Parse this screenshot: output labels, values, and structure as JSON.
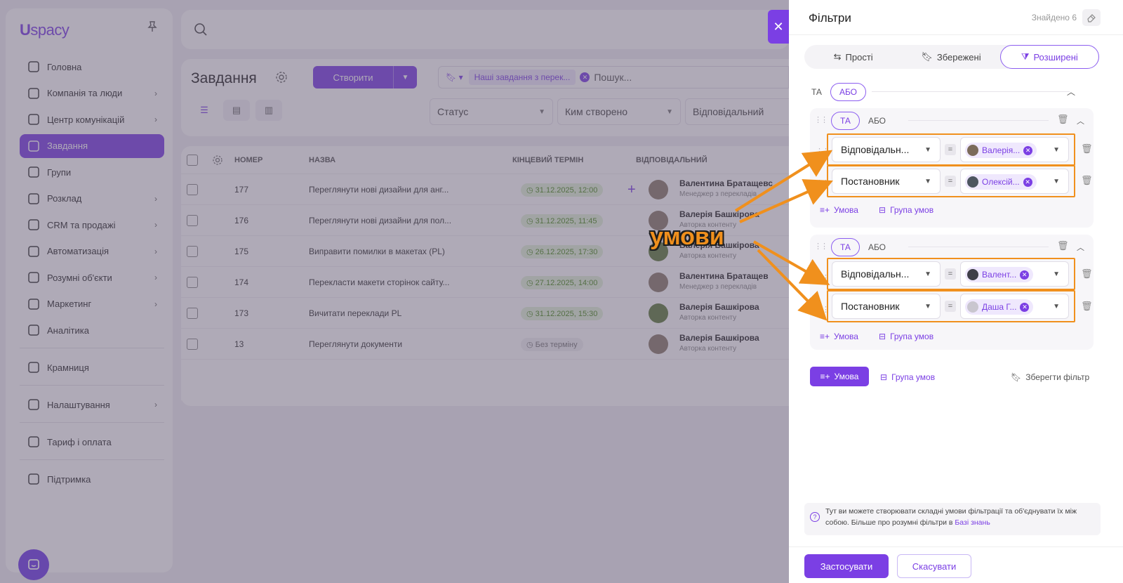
{
  "app": {
    "logo_mark": "U",
    "logo_text": "spacy",
    "nav": [
      {
        "label": "Головна",
        "icon": "home-icon",
        "chevron": false
      },
      {
        "label": "Компанія та люди",
        "icon": "company-icon",
        "chevron": true
      },
      {
        "label": "Центр комунікацій",
        "icon": "chat-center-icon",
        "chevron": true
      },
      {
        "label": "Завдання",
        "icon": "check-circle-icon",
        "chevron": false,
        "active": true
      },
      {
        "label": "Групи",
        "icon": "groups-icon",
        "chevron": false
      },
      {
        "label": "Розклад",
        "icon": "calendar-icon",
        "chevron": true
      },
      {
        "label": "CRM та продажі",
        "icon": "database-icon",
        "chevron": true
      },
      {
        "label": "Автоматизація",
        "icon": "lightning-icon",
        "chevron": true
      },
      {
        "label": "Розумні об'єкти",
        "icon": "smart-objects-icon",
        "chevron": true
      },
      {
        "label": "Маркетинг",
        "icon": "marketing-icon",
        "chevron": true
      },
      {
        "label": "Аналітика",
        "icon": "analytics-icon",
        "chevron": false
      }
    ],
    "nav_bottom": [
      {
        "label": "Крамниця",
        "icon": "store-icon",
        "chevron": false
      },
      {
        "label": "Налаштування",
        "icon": "settings-icon",
        "chevron": true
      },
      {
        "label": "Тариф і оплата",
        "icon": "wallet-icon",
        "chevron": false
      },
      {
        "label": "Підтримка",
        "icon": "support-icon",
        "chevron": false
      }
    ]
  },
  "tasks": {
    "title": "Завдання",
    "create_label": "Створити",
    "saved_filter_chip": "Наші завдання з перек...",
    "search_placeholder": "Пошук...",
    "filters": [
      "Статус",
      "Ким створено",
      "Відповідальний"
    ],
    "columns": {
      "number": "НОМЕР",
      "name": "НАЗВА",
      "deadline": "КІНЦЕВИЙ ТЕРМІН",
      "assignee": "ВІДПОВІДАЛЬНИЙ"
    },
    "rows": [
      {
        "number": "177",
        "name": "Переглянути нові дизайни для анг...",
        "deadline": "31.12.2025, 12:00",
        "person": "Валентина Братащевс",
        "role": "Менеджер з перекладів"
      },
      {
        "number": "176",
        "name": "Переглянути нові дизайни для пол...",
        "deadline": "31.12.2025, 11:45",
        "person": "Валерія Башкірова",
        "role": "Авторка контенту"
      },
      {
        "number": "175",
        "name": "Виправити помилки в макетах (PL)",
        "deadline": "26.12.2025, 17:30",
        "person": "Валерія Башкірова",
        "role": "Авторка контенту"
      },
      {
        "number": "174",
        "name": "Перекласти макети сторінок сайту...",
        "deadline": "27.12.2025, 14:00",
        "person": "Валентина Братащев",
        "role": "Менеджер з перекладів"
      },
      {
        "number": "173",
        "name": "Вичитати переклади PL",
        "deadline": "31.12.2025, 15:30",
        "person": "Валерія Башкірова",
        "role": "Авторка контенту"
      },
      {
        "number": "13",
        "name": "Переглянути документи",
        "deadline": "Без терміну",
        "person": "Валерія Башкірова",
        "role": "Авторка контенту"
      }
    ]
  },
  "panel": {
    "title": "Фільтри",
    "found": "Знайдено 6",
    "tabs": {
      "simple": "Прості",
      "saved": "Збережені",
      "advanced": "Розширені"
    },
    "logic_and": "ТА",
    "logic_or": "АБО",
    "groups": [
      {
        "conditions": [
          {
            "field": "Відповідальн...",
            "value": "Валерія..."
          },
          {
            "field": "Постановник",
            "value": "Олексій..."
          }
        ]
      },
      {
        "conditions": [
          {
            "field": "Відповідальн...",
            "value": "Валент..."
          },
          {
            "field": "Постановник",
            "value": "Даша Г..."
          }
        ]
      }
    ],
    "add_condition": "Умова",
    "add_group": "Група умов",
    "save_filter": "Зберегти фільтр",
    "info_text": "Тут ви можете створювати складні умови фільтрації та об'єднувати їх між собою. Більше про розумні фільтри в",
    "info_link": "Базі знань",
    "apply": "Застосувати",
    "cancel": "Скасувати"
  },
  "annotation": {
    "label": "умови",
    "color": "#f0901d"
  },
  "colors": {
    "accent": "#7b3fe4",
    "highlight": "#f0901d",
    "deadline_green": "#4a8a1c"
  }
}
